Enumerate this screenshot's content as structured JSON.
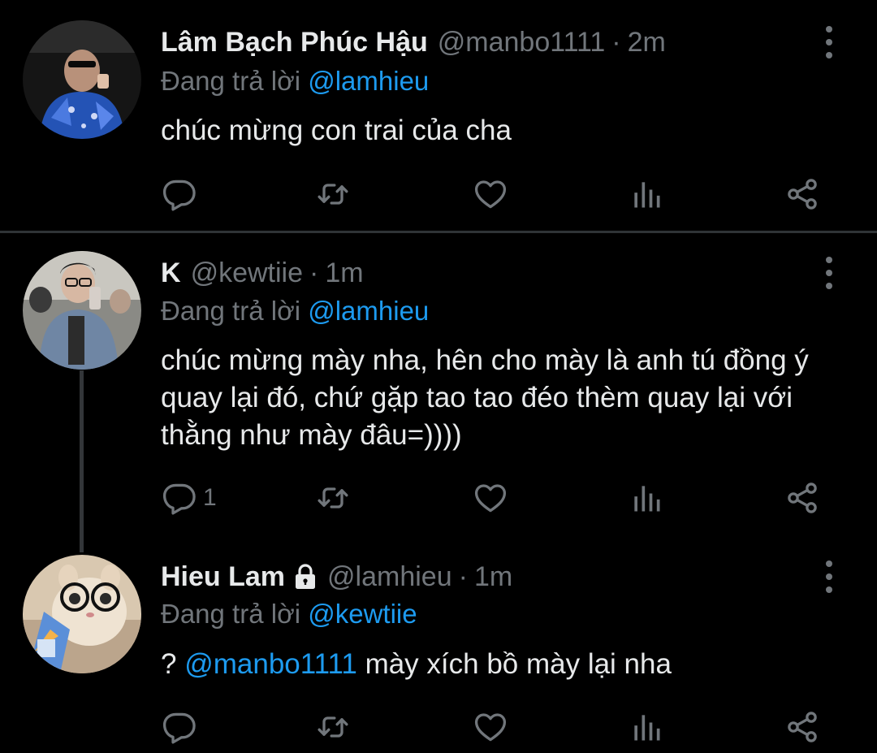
{
  "replying_label": "Đang trả lời",
  "tweets": [
    {
      "name": "Lâm Bạch Phúc Hậu",
      "handle": "@manbo1111",
      "dot": "·",
      "time": "2m",
      "replying_to": "@lamhieu",
      "text": "chúc mừng con trai của cha",
      "reply_count": ""
    },
    {
      "name": "K",
      "handle": "@kewtiie",
      "dot": "·",
      "time": "1m",
      "replying_to": "@lamhieu",
      "text": "chúc mừng mày nha, hên cho mày là anh tú đồng ý quay lại đó, chứ gặp tao tao đéo thèm quay lại với thằng như mày đâu=))))",
      "reply_count": "1"
    },
    {
      "name": "Hieu Lam",
      "handle": "@lamhieu",
      "dot": "·",
      "time": "1m",
      "replying_to": "@kewtiie",
      "text_prefix": "?",
      "text_mention": "@manbo1111",
      "text_suffix": "mày xích bồ mày lại nha",
      "reply_count": "",
      "protected": true
    }
  ],
  "icons": [
    "reply-icon",
    "retweet-icon",
    "like-icon",
    "analytics-icon",
    "share-icon",
    "more-icon",
    "lock-icon"
  ],
  "colors": {
    "background": "#000000",
    "text": "#e7e9ea",
    "muted": "#71767b",
    "accent": "#1d9bf0"
  }
}
